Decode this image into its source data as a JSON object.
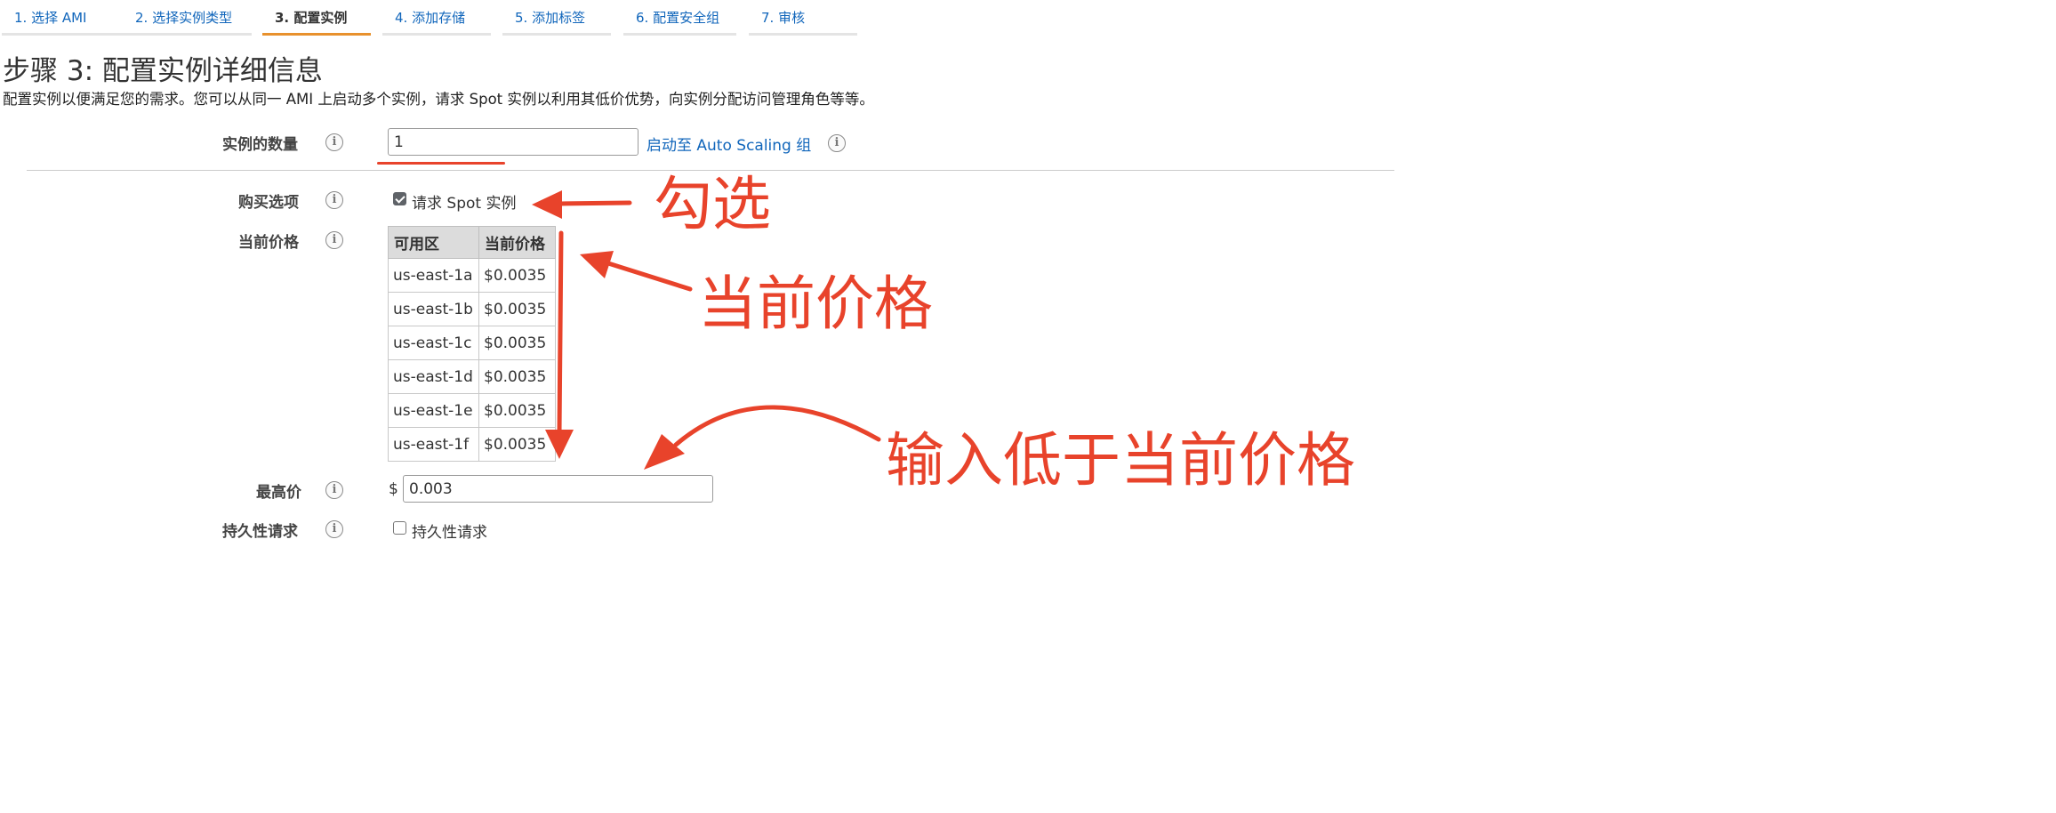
{
  "steps": [
    {
      "label": "1. 选择 AMI",
      "active": false
    },
    {
      "label": "2. 选择实例类型",
      "active": false
    },
    {
      "label": "3. 配置实例",
      "active": true
    },
    {
      "label": "4. 添加存储",
      "active": false
    },
    {
      "label": "5. 添加标签",
      "active": false
    },
    {
      "label": "6. 配置安全组",
      "active": false
    },
    {
      "label": "7. 审核",
      "active": false
    }
  ],
  "page": {
    "title": "步骤 3: 配置实例详细信息",
    "description": "配置实例以便满足您的需求。您可以从同一 AMI 上启动多个实例，请求 Spot 实例以利用其低价优势，向实例分配访问管理角色等等。"
  },
  "form": {
    "instance_count": {
      "label": "实例的数量",
      "value": "1",
      "link": "启动至 Auto Scaling 组"
    },
    "purchase_option": {
      "label": "购买选项",
      "checkbox_label": "请求 Spot 实例",
      "checked": true
    },
    "current_price": {
      "label": "当前价格",
      "headers": [
        "可用区",
        "当前价格"
      ],
      "rows": [
        [
          "us-east-1a",
          "$0.0035"
        ],
        [
          "us-east-1b",
          "$0.0035"
        ],
        [
          "us-east-1c",
          "$0.0035"
        ],
        [
          "us-east-1d",
          "$0.0035"
        ],
        [
          "us-east-1e",
          "$0.0035"
        ],
        [
          "us-east-1f",
          "$0.0035"
        ]
      ]
    },
    "max_price": {
      "label": "最高价",
      "currency": "$",
      "value": "0.003"
    },
    "persistent_request": {
      "label": "持久性请求",
      "checkbox_label": "持久性请求",
      "checked": false
    },
    "info_icon_glyph": "i"
  },
  "annotations": {
    "check": "勾选",
    "current_price": "当前价格",
    "enter_lower": "输入低于当前价格",
    "color": "#e8432b"
  }
}
